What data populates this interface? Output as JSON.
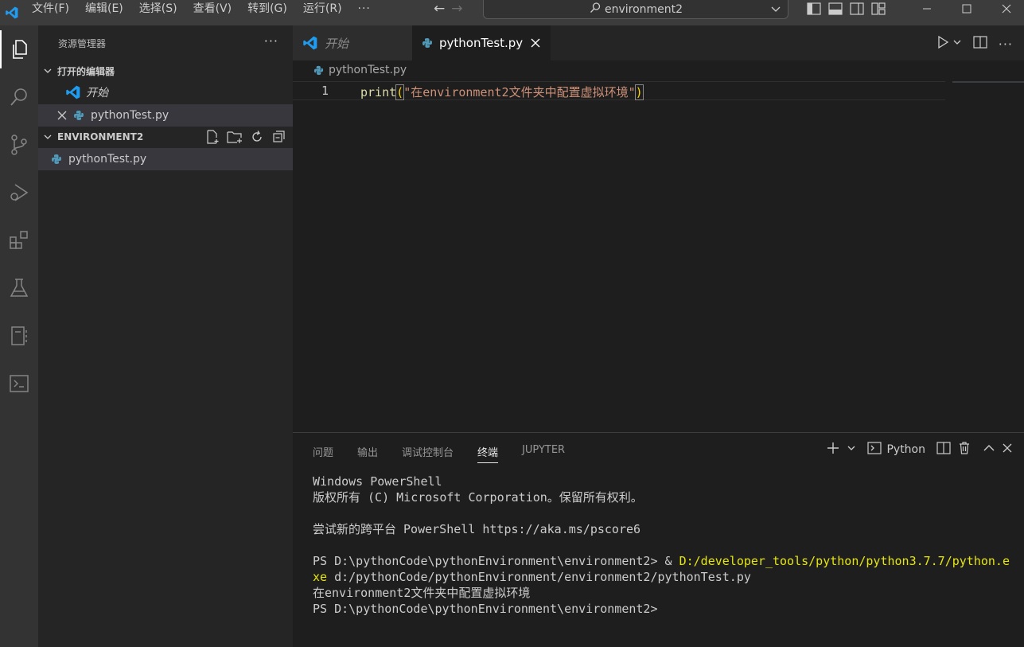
{
  "titlebar": {
    "menu": [
      "文件(F)",
      "编辑(E)",
      "选择(S)",
      "查看(V)",
      "转到(G)",
      "运行(R)"
    ],
    "more": "···",
    "search_text": "environment2"
  },
  "sidebar": {
    "title": "资源管理器",
    "more": "···",
    "open_editors_header": "打开的编辑器",
    "open_editors": [
      {
        "label": "开始"
      },
      {
        "label": "pythonTest.py"
      }
    ],
    "folder_header": "ENVIRONMENT2",
    "files": [
      {
        "label": "pythonTest.py"
      }
    ]
  },
  "editor": {
    "tabs": [
      {
        "label": "开始"
      },
      {
        "label": "pythonTest.py"
      }
    ],
    "breadcrumb": "pythonTest.py",
    "line_number": "1",
    "code": {
      "fn": "print",
      "open": "(",
      "string": "\"在environment2文件夹中配置虚拟环境\"",
      "close": ")"
    }
  },
  "panel": {
    "tabs": [
      "问题",
      "输出",
      "调试控制台",
      "终端",
      "JUPYTER"
    ],
    "active_tab": "终端",
    "terminal_label": "Python",
    "terminal_lines": {
      "l1": "Windows PowerShell",
      "l2": "版权所有 (C) Microsoft Corporation。保留所有权利。",
      "l3": "",
      "l4": "尝试新的跨平台 PowerShell https://aka.ms/pscore6",
      "l5": "",
      "l6_prompt": "PS D:\\pythonCode\\pythonEnvironment\\environment2> & ",
      "l6_cmd": "D:/developer_tools/python/python3.7.7/python.e",
      "l7_cmd": "xe",
      "l7_rest": " d:/pythonCode/pythonEnvironment/environment2/pythonTest.py",
      "l8": "在environment2文件夹中配置虚拟环境",
      "l9": "PS D:\\pythonCode\\pythonEnvironment\\environment2>"
    }
  },
  "colors": {
    "accent": "#007acc",
    "python_icon": "#519aba",
    "string": "#ce9178",
    "function": "#dcdcaa",
    "terminal_command": "#e5e510"
  }
}
